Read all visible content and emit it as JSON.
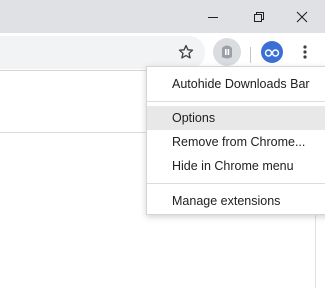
{
  "window_controls": {
    "minimize_icon": "minimize-icon",
    "restore_icon": "restore-icon",
    "close_icon": "close-icon"
  },
  "toolbar": {
    "bookmark_icon": "star-icon",
    "extension_icon": "extension-icon",
    "profile_icon": "profile-avatar",
    "menu_icon": "three-dot-menu-icon"
  },
  "context_menu": {
    "title": "Autohide Downloads Bar",
    "items": [
      "Options",
      "Remove from Chrome...",
      "Hide in Chrome menu"
    ],
    "footer": "Manage extensions",
    "highlighted": "Options"
  },
  "colors": {
    "titlebar": "#dfe1e5",
    "omnibox": "#f1f3f4",
    "menu_highlight": "#e8e8e8",
    "avatar": "#3b6fd8"
  }
}
